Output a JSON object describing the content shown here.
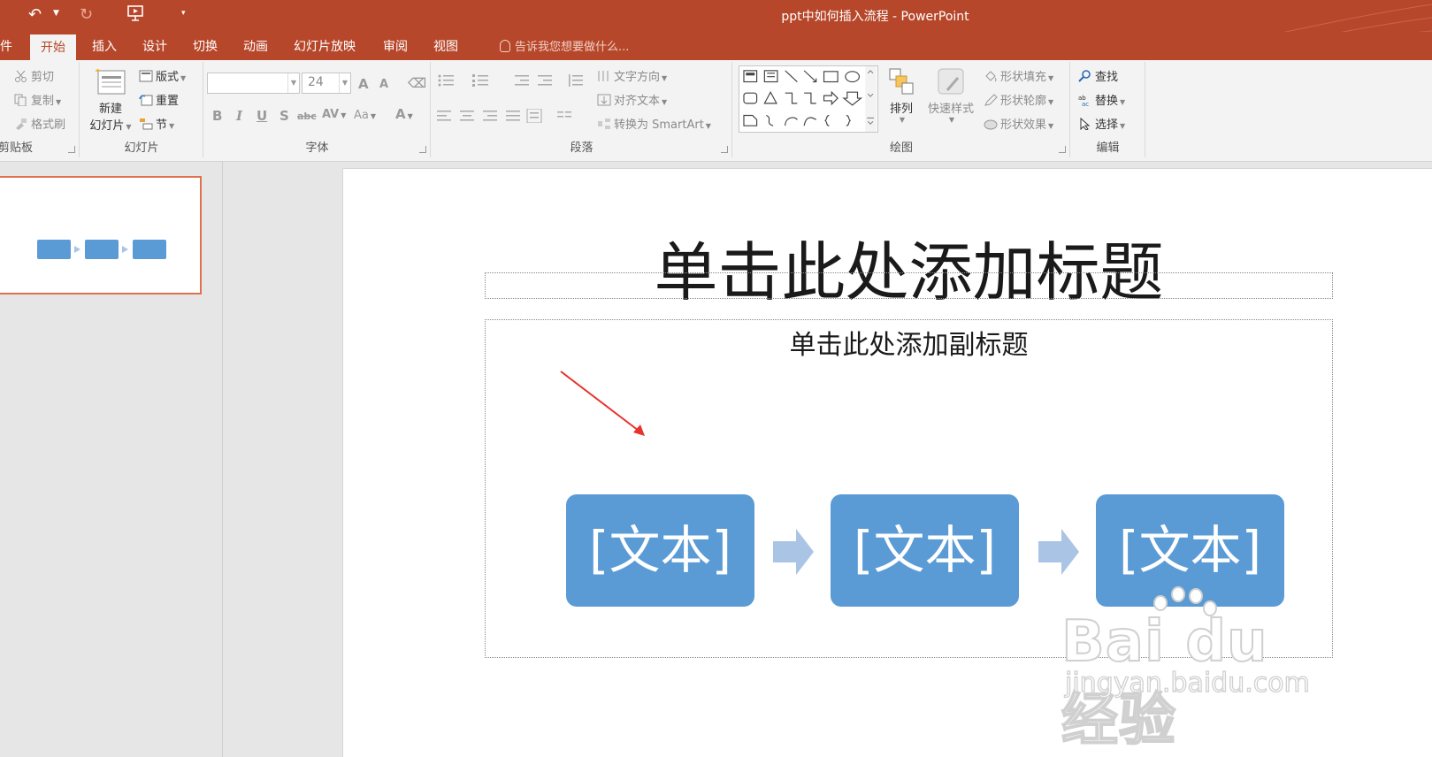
{
  "window": {
    "title": "ppt中如何插入流程 - PowerPoint"
  },
  "tabs": {
    "file": "件",
    "home": "开始",
    "insert": "插入",
    "design": "设计",
    "transitions": "切换",
    "animations": "动画",
    "slideshow": "幻灯片放映",
    "review": "审阅",
    "view": "视图",
    "tellme": "告诉我您想要做什么..."
  },
  "clipboard": {
    "cut": "剪切",
    "copy": "复制",
    "painter": "格式刷",
    "label": "剪贴板"
  },
  "slides_group": {
    "new_slide_1": "新建",
    "new_slide_2": "幻灯片",
    "layout": "版式",
    "reset": "重置",
    "section": "节",
    "label": "幻灯片"
  },
  "font_group": {
    "font_name": "",
    "font_size": "24",
    "grow": "A",
    "shrink": "A",
    "bold": "B",
    "italic": "I",
    "underline": "U",
    "shadow": "S",
    "strike": "abc",
    "spacing": "AV",
    "case": "Aa",
    "color": "A",
    "label": "字体"
  },
  "paragraph_group": {
    "text_direction": "文字方向",
    "align_text": "对齐文本",
    "smartart": "转换为 SmartArt",
    "label": "段落"
  },
  "drawing_group": {
    "arrange": "排列",
    "quick_styles": "快速样式",
    "fill": "形状填充",
    "outline": "形状轮廓",
    "effects": "形状效果",
    "label": "绘图"
  },
  "editing_group": {
    "find": "查找",
    "replace": "替换",
    "select": "选择",
    "label": "编辑"
  },
  "slide": {
    "title": "单击此处添加标题",
    "subtitle": "单击此处添加副标题",
    "process": [
      "[文本]",
      "[文本]",
      "[文本]"
    ]
  },
  "watermark": {
    "logo": "Bai du 经验",
    "url": "jingyan.baidu.com"
  },
  "colors": {
    "accent": "#b7472a",
    "smartart_box": "#5b9bd5",
    "smartart_arrow": "#a9c4e4",
    "selection": "#e0714f",
    "annotation_arrow": "#e8322c"
  }
}
